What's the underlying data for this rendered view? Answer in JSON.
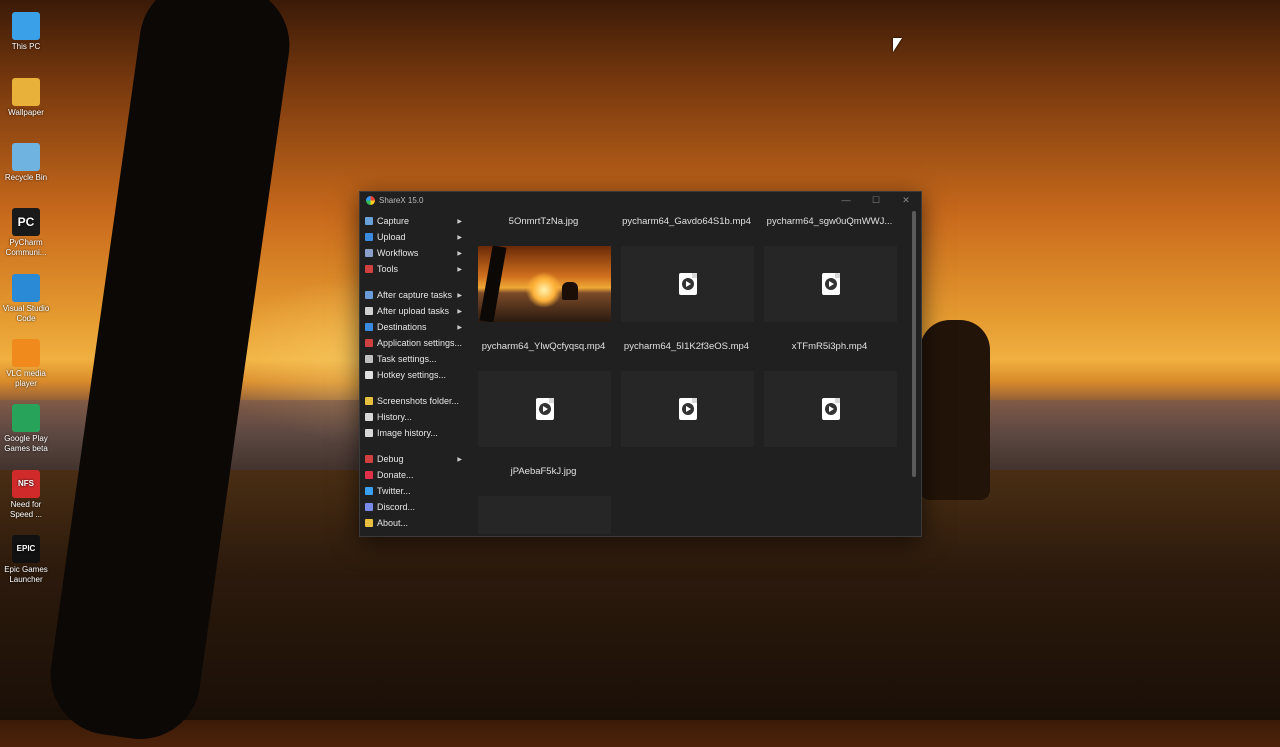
{
  "desktop": {
    "icons": [
      {
        "label": "This PC",
        "icon": "monitor-icon",
        "color": "#3aa0e8"
      },
      {
        "label": "Wallpaper",
        "icon": "folder-icon",
        "color": "#e8b23a"
      },
      {
        "label": "Recycle Bin",
        "icon": "recycle-bin-icon",
        "color": "#6fb3e0"
      },
      {
        "label": "PyCharm Communi...",
        "icon": "pycharm-icon",
        "color": "#1a1a1a",
        "glyph": "PC"
      },
      {
        "label": "Visual Studio Code",
        "icon": "vscode-icon",
        "color": "#2a8ad6"
      },
      {
        "label": "VLC media player",
        "icon": "vlc-icon",
        "color": "#f08a1c"
      },
      {
        "label": "Google Play Games beta",
        "icon": "google-play-games-icon",
        "color": "#27a35a"
      },
      {
        "label": "Need for Speed ...",
        "icon": "need-for-speed-icon",
        "color": "#d02a2a",
        "glyph": "NFS"
      },
      {
        "label": "Epic Games Launcher",
        "icon": "epic-games-icon",
        "color": "#111111",
        "glyph": "EPIC"
      }
    ]
  },
  "window": {
    "title": "ShareX 15.0",
    "controls": {
      "minimize": "—",
      "maximize": "☐",
      "close": "✕"
    }
  },
  "menu": {
    "items": [
      {
        "label": "Capture",
        "icon": "capture-icon",
        "color": "#6aa0d8",
        "submenu": true
      },
      {
        "label": "Upload",
        "icon": "upload-arrow-icon",
        "color": "#3a8ae0",
        "submenu": true
      },
      {
        "label": "Workflows",
        "icon": "workflows-icon",
        "color": "#8aa0c8",
        "submenu": true
      },
      {
        "label": "Tools",
        "icon": "tools-icon",
        "color": "#d04040",
        "submenu": true
      },
      {
        "sep": true
      },
      {
        "label": "After capture tasks",
        "icon": "after-capture-icon",
        "color": "#6a9ad8",
        "submenu": true
      },
      {
        "label": "After upload tasks",
        "icon": "after-upload-icon",
        "color": "#d0d0d0",
        "submenu": true
      },
      {
        "label": "Destinations",
        "icon": "destinations-icon",
        "color": "#3a8ae0",
        "submenu": true
      },
      {
        "label": "Application settings...",
        "icon": "application-settings-icon",
        "color": "#d04040",
        "submenu": false
      },
      {
        "label": "Task settings...",
        "icon": "task-settings-icon",
        "color": "#c0c0c0",
        "submenu": false
      },
      {
        "label": "Hotkey settings...",
        "icon": "hotkey-settings-icon",
        "color": "#e0e0e0",
        "submenu": false
      },
      {
        "sep": true
      },
      {
        "label": "Screenshots folder...",
        "icon": "screenshots-folder-icon",
        "color": "#e8c040",
        "submenu": false
      },
      {
        "label": "History...",
        "icon": "history-icon",
        "color": "#d8d8d8",
        "submenu": false
      },
      {
        "label": "Image history...",
        "icon": "image-history-icon",
        "color": "#d8d8d8",
        "submenu": false
      },
      {
        "sep": true
      },
      {
        "label": "Debug",
        "icon": "debug-icon",
        "color": "#d04040",
        "submenu": true
      },
      {
        "label": "Donate...",
        "icon": "heart-icon",
        "color": "#e0304a",
        "submenu": false
      },
      {
        "label": "Twitter...",
        "icon": "twitter-icon",
        "color": "#3aa0f0",
        "submenu": false
      },
      {
        "label": "Discord...",
        "icon": "discord-icon",
        "color": "#7a8ae8",
        "submenu": false
      },
      {
        "label": "About...",
        "icon": "about-icon",
        "color": "#e8c040",
        "submenu": false
      }
    ]
  },
  "files": [
    {
      "name": "5OnmrtTzNa.jpg",
      "kind": "image"
    },
    {
      "name": "pycharm64_Gavdo64S1b.mp4",
      "kind": "video"
    },
    {
      "name": "pycharm64_sgw0uQmWWJ...",
      "kind": "video"
    },
    {
      "name": "pycharm64_YlwQcfyqsq.mp4",
      "kind": "video"
    },
    {
      "name": "pycharm64_5I1K2f3eOS.mp4",
      "kind": "video"
    },
    {
      "name": "xTFmR5i3ph.mp4",
      "kind": "video"
    },
    {
      "name": "jPAebaF5kJ.jpg",
      "kind": "image-file"
    }
  ]
}
